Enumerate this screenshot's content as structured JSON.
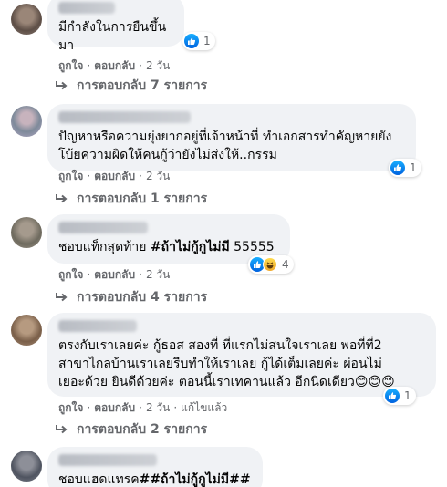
{
  "comments": [
    {
      "text": "มีกำลังในการยืนขึ้นมา",
      "reactions": {
        "icons": [
          "like-icon"
        ],
        "count": "1"
      },
      "actions": {
        "like": "ถูกใจ",
        "reply": "ตอบกลับ",
        "time": "2 วัน",
        "edited": ""
      },
      "replies": "การตอบกลับ 7 รายการ"
    },
    {
      "text": "ปัญหาหรือความยุ่งยากอยู่ที่เจ้าหน้าที่ ทำเอกสารทำคัญหายยัง\nโบ้ยความผิดให้คนกู้ว่ายังไม่ส่งให้..กรรม",
      "reactions": {
        "icons": [
          "like-icon"
        ],
        "count": "1"
      },
      "actions": {
        "like": "ถูกใจ",
        "reply": "ตอบกลับ",
        "time": "2 วัน",
        "edited": ""
      },
      "replies": "การตอบกลับ 1 รายการ"
    },
    {
      "text_prefix": "ชอบแท็กสุดท้าย ",
      "text_tag": "#ถ้าไม่กู้กูไม่มี",
      "text_suffix": " 55555",
      "reactions": {
        "icons": [
          "like-icon",
          "haha-icon"
        ],
        "count": "4"
      },
      "actions": {
        "like": "ถูกใจ",
        "reply": "ตอบกลับ",
        "time": "2 วัน",
        "edited": ""
      },
      "replies": "การตอบกลับ 4 รายการ"
    },
    {
      "text": "ตรงกับเราเลยค่ะ กู้ธอส สองที่ ที่แรกไม่สนใจเราเลย พอที่ที่2\nสาขาไกลบ้านเราเลยรีบทำให้เราเลย กู้ได้เต็มเลยค่ะ ผ่อนไม่\nเยอะด้วย ยินดีด้วยค่ะ ตอนนี้เราเทคานแล้ว อีกนิดเดียว😊😊😊",
      "reactions": {
        "icons": [
          "like-icon"
        ],
        "count": "1"
      },
      "actions": {
        "like": "ถูกใจ",
        "reply": "ตอบกลับ",
        "time": "2 วัน",
        "edited": "แก้ไขแล้ว"
      },
      "replies": "การตอบกลับ 2 รายการ"
    },
    {
      "text_prefix": "ชอบแฮดแทรค",
      "text_tag": "##ถ้าไม่กู้กูไม่มี##",
      "text_suffix": ""
    }
  ],
  "colors": {
    "bubble": "#f0f2f5",
    "meta": "#65676b",
    "like": "#1877f2"
  }
}
